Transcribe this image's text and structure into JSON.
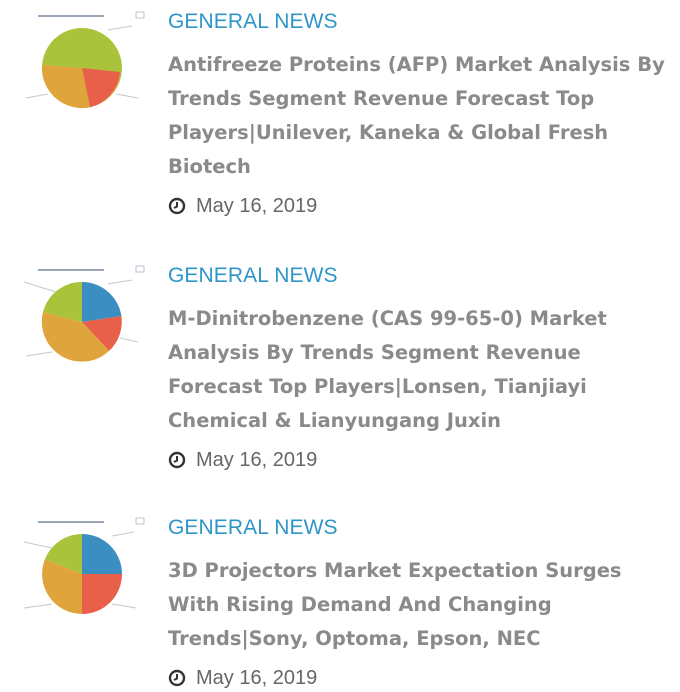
{
  "colors": {
    "category": "#2f95c9",
    "title": "#8a8a8a",
    "date": "#666666",
    "pie_green": "#a9c43a",
    "pie_orange": "#e0a43c",
    "pie_red": "#e8604a",
    "pie_blue": "#3b8ec1"
  },
  "articles": [
    {
      "category": "GENERAL NEWS",
      "title": "Antifreeze Proteins (AFP) Market Analysis By Trends Segment Revenue Forecast Top Players|Unilever, Kaneka & Global Fresh Biotech",
      "date": "May 16, 2019",
      "thumbnail_icon": "pie-chart-thumbnail"
    },
    {
      "category": "GENERAL NEWS",
      "title": "M-Dinitrobenzene (CAS 99-65-0) Market Analysis By Trends Segment Revenue Forecast Top Players|Lonsen, Tianjiayi Chemical & Lianyungang Juxin",
      "date": "May 16, 2019",
      "thumbnail_icon": "pie-chart-thumbnail"
    },
    {
      "category": "GENERAL NEWS",
      "title": "3D Projectors Market Expectation Surges With Rising Demand And Changing Trends|Sony, Optoma, Epson, NEC",
      "date": "May 16, 2019",
      "thumbnail_icon": "pie-chart-thumbnail"
    }
  ]
}
